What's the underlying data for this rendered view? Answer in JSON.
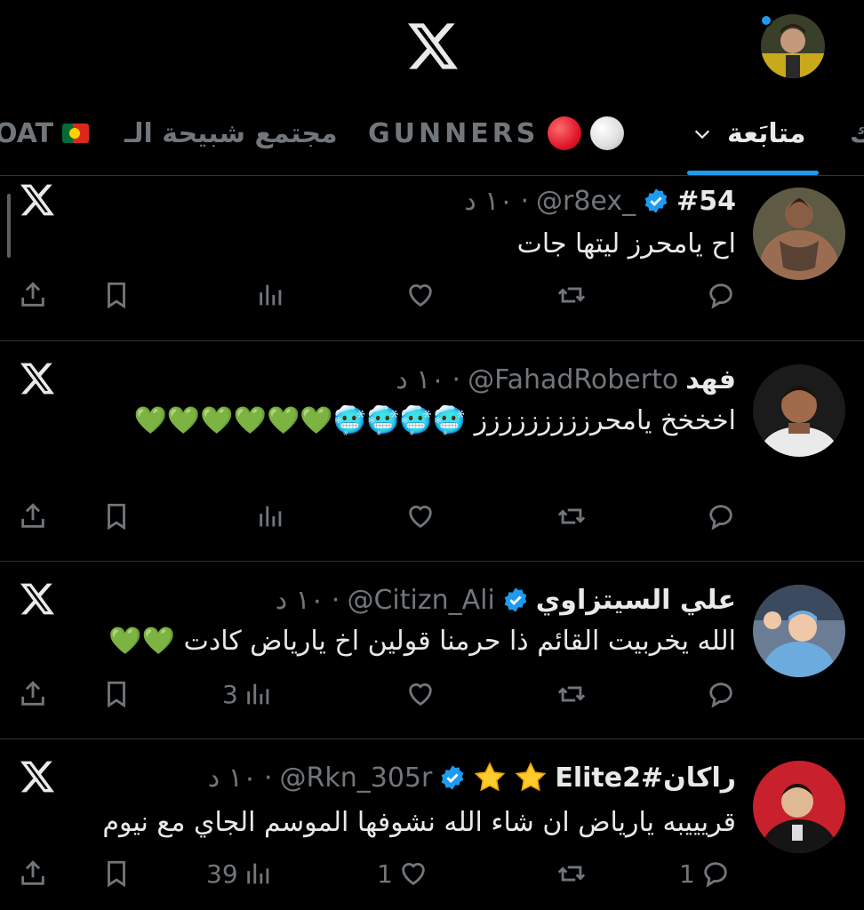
{
  "header": {
    "logo": "x-logo",
    "has_notification_dot": true
  },
  "tabs": [
    {
      "label": "متابَعة",
      "active": true
    },
    {
      "label": "GUNNERS",
      "active": false
    },
    {
      "label": "مجتمع شبيحة الـ",
      "active": false
    },
    {
      "label": "OAT",
      "active": false
    },
    {
      "label": "ك",
      "active": false
    }
  ],
  "colors": {
    "accent": "#1d9bf0",
    "background": "#000000",
    "muted": "#71767b",
    "text": "#e7e9ea",
    "divider": "#2f3336"
  },
  "tweets": [
    {
      "name": "#54",
      "verified": true,
      "handle": "@r8ex_",
      "time": "١٠ د",
      "text": "اح يامحرز ليتها جات",
      "emoji_line": "",
      "counts": {
        "reply": "",
        "retweet": "",
        "like": "",
        "views": ""
      }
    },
    {
      "name": "فهد",
      "verified": false,
      "handle": "@FahadRoberto",
      "time": "١٠ د",
      "text": "اخخخخ يامحرززززززززز",
      "emoji_line": "🥶🥶🥶🥶💚💚💚💚💚💚",
      "counts": {
        "reply": "",
        "retweet": "",
        "like": "",
        "views": ""
      }
    },
    {
      "name": "علي السيتزاوي",
      "verified": true,
      "handle": "@Citizn_Ali",
      "time": "١٠ د",
      "text": "الله يخربيت القائم ذا حرمنا قولين اخ ياriياض كادت",
      "emoji_line": "💚💚",
      "counts": {
        "reply": "",
        "retweet": "",
        "like": "",
        "views": "3"
      }
    },
    {
      "name": "راكان#Elite2",
      "verified": true,
      "handle": "@Rkn_305r",
      "time": "١٠ د",
      "text": "قريييبه يارياض ان شاء الله نشوفها الموسم الجاي مع نيوم",
      "emoji_line": "",
      "counts": {
        "reply": "1",
        "retweet": "",
        "like": "1",
        "views": "39"
      }
    }
  ]
}
